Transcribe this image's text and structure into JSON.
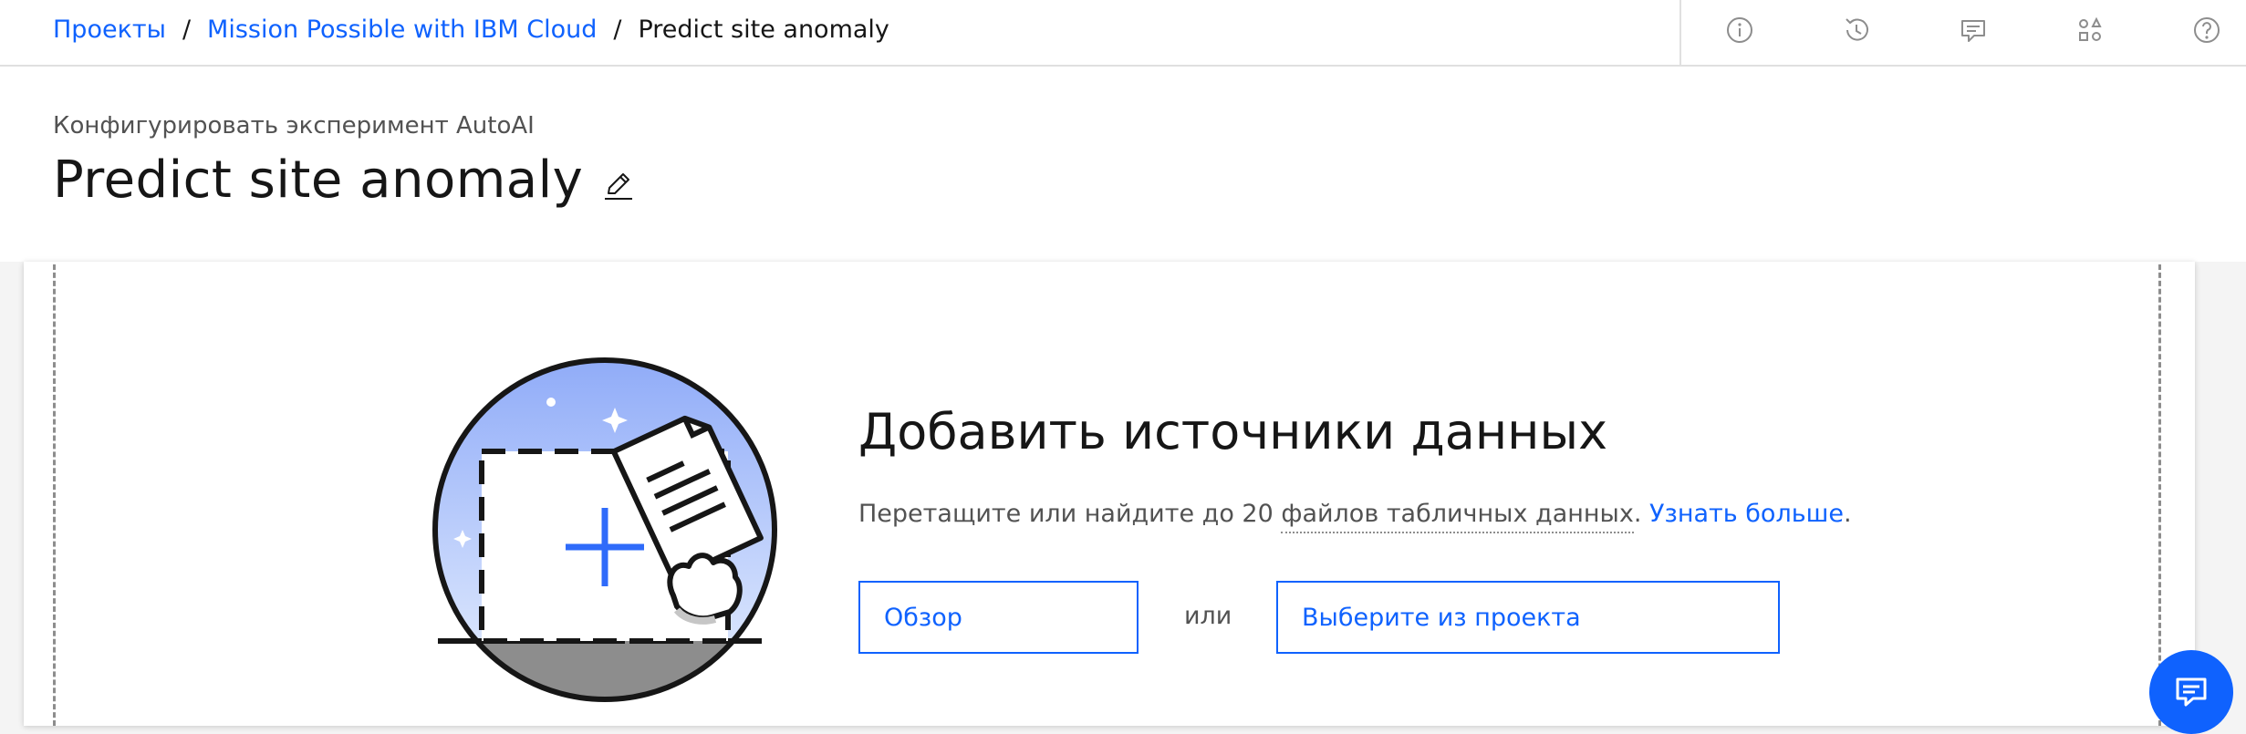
{
  "breadcrumb": {
    "items": [
      "Проекты",
      "Mission Possible with IBM Cloud"
    ],
    "separator": "/",
    "current": "Predict site anomaly"
  },
  "toolbar": {
    "icons": [
      "info-icon",
      "history-icon",
      "comment-icon",
      "apps-icon",
      "help-icon"
    ]
  },
  "header": {
    "subtitle": "Конфигурировать эксперимент AutoAI",
    "title": "Predict site anomaly",
    "edit_icon": "edit-icon"
  },
  "drop_zone": {
    "title": "Добавить источники данных",
    "text_before": "Перетащите или найдите до 20 ",
    "text_term": "файлов табличных данных",
    "text_period": ".",
    "learn_more": "Узнать больше",
    "browse_button": "Обзор",
    "or_text": "или",
    "select_button": "Выберите из проекта"
  },
  "chat": {
    "icon": "chat-icon"
  },
  "colors": {
    "accent": "#0f62fe",
    "illustration_sky_top": "#8eaaf8",
    "illustration_ground": "#8d8d8d"
  }
}
